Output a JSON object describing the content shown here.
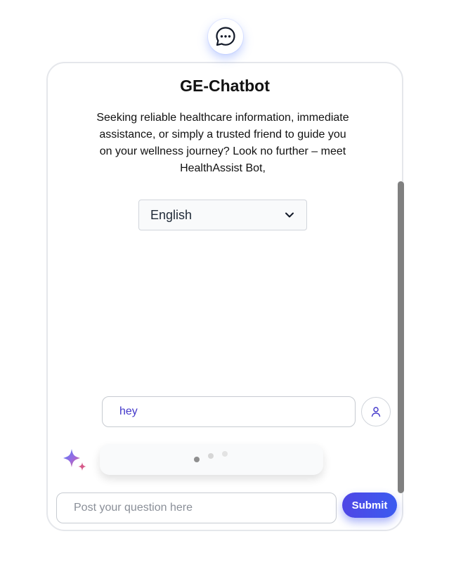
{
  "header": {
    "chat_icon": "chat-bubble-dots-icon"
  },
  "card": {
    "title": "GE-Chatbot",
    "description": "Seeking reliable healthcare information, immediate assistance, or simply a trusted friend to guide you on your wellness journey? Look no further – meet HealthAssist Bot,",
    "language_select": {
      "selected": "English",
      "icon": "chevron-down-icon"
    }
  },
  "conversation": {
    "user_message": "hey",
    "user_avatar_icon": "user-icon",
    "bot_icon": "sparkle-icon",
    "bot_typing": true
  },
  "composer": {
    "placeholder": "Post your question here",
    "value": "",
    "submit_label": "Submit"
  },
  "colors": {
    "accent": "#4f46e5",
    "user_text": "#4338ca",
    "border": "#e5e7eb"
  }
}
